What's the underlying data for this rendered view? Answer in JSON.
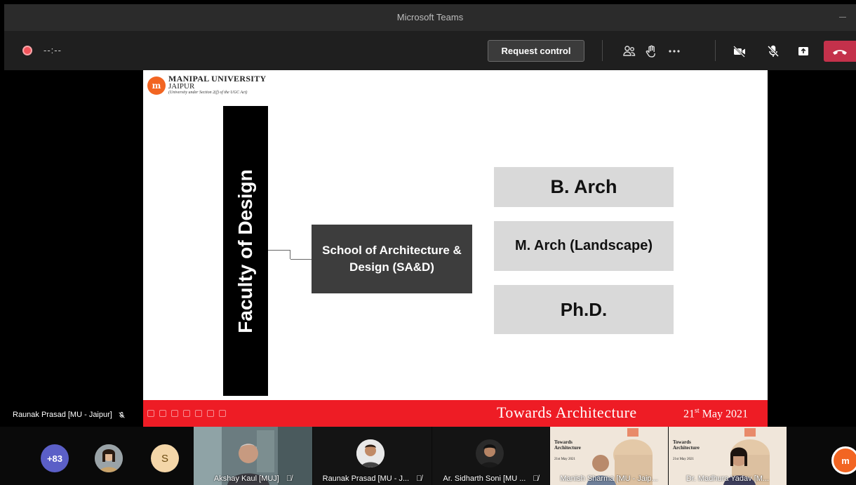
{
  "window": {
    "title": "Microsoft Teams"
  },
  "controls": {
    "timer": "--:--",
    "request_control_label": "Request control",
    "icons": [
      "participants-icon",
      "reactions-icon",
      "more-icon",
      "camera-off-icon",
      "mic-off-icon",
      "share-icon",
      "hangup-icon"
    ]
  },
  "slide": {
    "logo": {
      "line1": "MANIPAL UNIVERSITY",
      "line2": "JAIPUR",
      "line3": "(University under Section 2(f) of the UGC Act)"
    },
    "faculty_label": "Faculty of Design",
    "school_label": "School of Architecture & Design (SA&D)",
    "programs": [
      "B. Arch",
      "M. Arch (Landscape)",
      "Ph.D."
    ],
    "footer_title": "Towards Architecture",
    "footer_date_day": "21",
    "footer_date_suffix": "st",
    "footer_date_rest": " May 2021"
  },
  "presenter": {
    "name": "Raunak Prasad [MU - Jaipur]"
  },
  "participants": {
    "more_count": "+83",
    "s_initial": "S",
    "tiles": [
      {
        "name": "Akshay Kaul [MUJ]"
      },
      {
        "name": "Raunak Prasad [MU - J..."
      },
      {
        "name": "Ar. Sidharth Soni [MU ..."
      },
      {
        "name": "Manish Sharma [MU - Jaip..."
      },
      {
        "name": "Dr. Madhura Yadav [M..."
      }
    ],
    "poster_title": "Towards Architecture",
    "poster_date": "21st May 2021"
  },
  "colors": {
    "accent_red": "#ee1c25",
    "teams_purple": "#5b5fc7",
    "hangup_red": "#c4314b"
  }
}
